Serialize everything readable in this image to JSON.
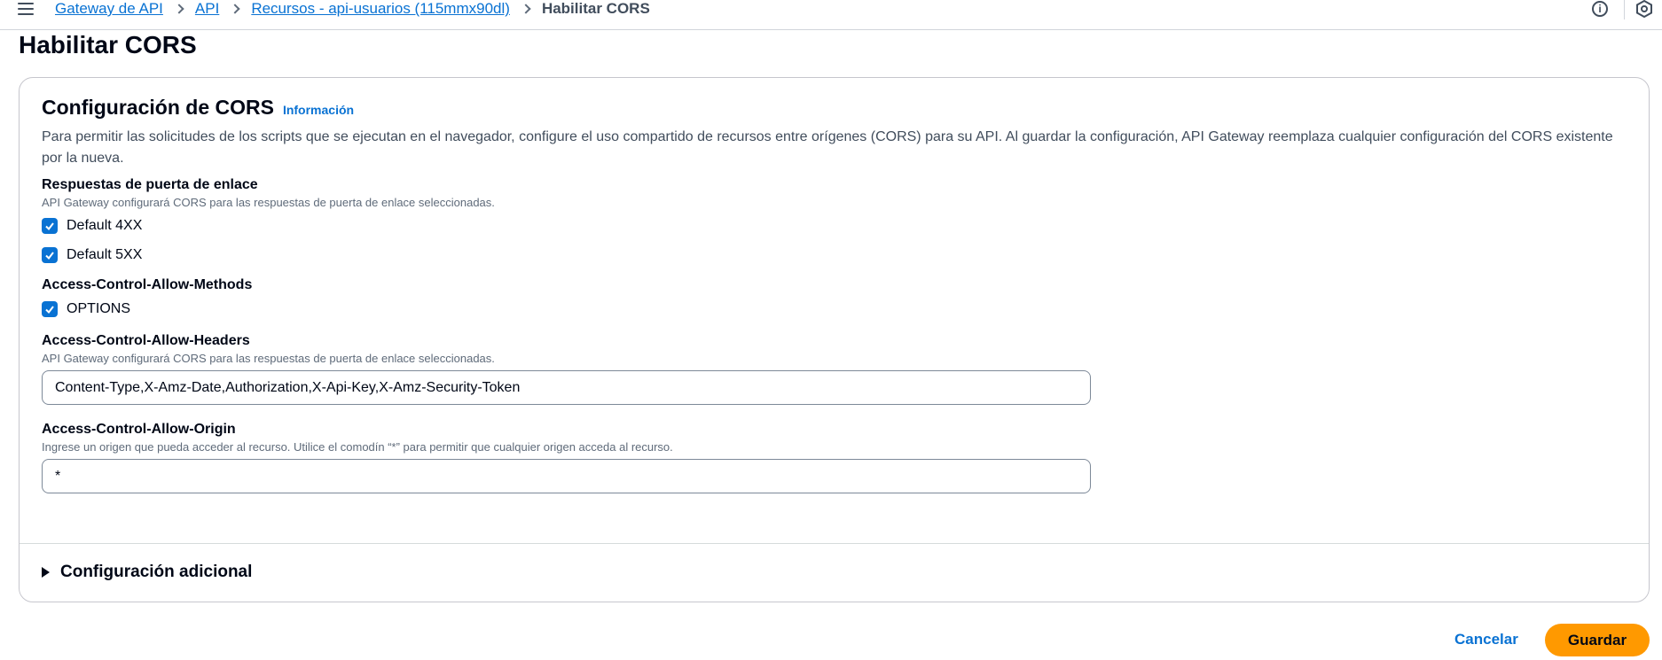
{
  "breadcrumb": {
    "items": [
      "Gateway de API",
      "API",
      "Recursos - api-usuarios (115mmx90dl)"
    ],
    "current": "Habilitar CORS"
  },
  "top_icons": [
    "info-icon",
    "cloudshell-hex-icon"
  ],
  "page": {
    "title": "Habilitar CORS"
  },
  "cors": {
    "title": "Configuración de CORS",
    "info_link": "Información",
    "description": "Para permitir las solicitudes de los scripts que se ejecutan en el navegador, configure el uso compartido de recursos entre orígenes (CORS) para su API. Al guardar la configuración, API Gateway reemplaza cualquier configuración del CORS existente por la nueva."
  },
  "gateway_responses": {
    "label": "Respuestas de puerta de enlace",
    "hint": "API Gateway configurará CORS para las respuestas de puerta de enlace seleccionadas.",
    "options": [
      {
        "label": "Default 4XX",
        "checked": true
      },
      {
        "label": "Default 5XX",
        "checked": true
      }
    ]
  },
  "allow_methods": {
    "label": "Access-Control-Allow-Methods",
    "options": [
      {
        "label": "OPTIONS",
        "checked": true
      }
    ]
  },
  "allow_headers": {
    "label": "Access-Control-Allow-Headers",
    "hint": "API Gateway configurará CORS para las respuestas de puerta de enlace seleccionadas.",
    "value": "Content-Type,X-Amz-Date,Authorization,X-Api-Key,X-Amz-Security-Token"
  },
  "allow_origin": {
    "label": "Access-Control-Allow-Origin",
    "hint": "Ingrese un origen que pueda acceder al recurso. Utilice el comodín “*” para permitir que cualquier origen acceda al recurso.",
    "value": "*"
  },
  "additional": {
    "label": "Configuración adicional",
    "expanded": false
  },
  "footer": {
    "cancel_label": "Cancelar",
    "save_label": "Guardar"
  },
  "colors": {
    "link": "#0972d3",
    "primary_button": "#ff9900",
    "checkbox": "#0972d3",
    "text": "#000716"
  }
}
